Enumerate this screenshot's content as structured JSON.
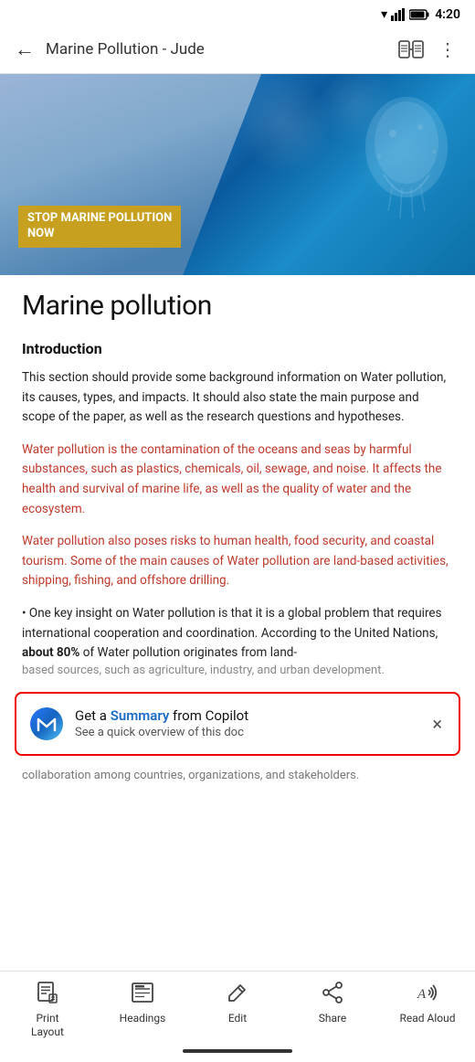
{
  "status_bar": {
    "time": "4:20"
  },
  "top_nav": {
    "title": "Marine Pollution - Jude",
    "back_label": "←",
    "more_label": "⋮"
  },
  "hero": {
    "text_line1": "STOP MARINE POLLUTION",
    "text_line2": "NOW"
  },
  "document": {
    "title": "Marine pollution",
    "section1_heading": "Introduction",
    "body_para1": "This section should provide some background information on Water pollution, its causes, types, and impacts. It should also state the main purpose and scope of the paper, as well as the research questions and hypotheses.",
    "red_para1": "Water pollution is the contamination of the oceans and seas by harmful substances, such as plastics, chemicals, oil, sewage, and noise. It affects the health and survival of marine life, as well as the quality of water and the ecosystem.",
    "red_para2": "Water pollution also poses risks to human health, food security, and coastal tourism. Some of the main causes of Water pollution are land-based activities, shipping, fishing, and offshore drilling.",
    "mixed_para_start": "• One key insight on Water pollution is that it is a global problem that requires international cooperation and coordination. According to the United Nations, ",
    "mixed_para_bold": "about 80%",
    "mixed_para_end": " of Water pollution originates from land-based sources, such as agriculture, industry, and urban development.",
    "trailing_text": "collaboration among countries, organizations, and stakeholders."
  },
  "copilot_banner": {
    "title_prefix": "Get a ",
    "title_link": "Summary",
    "title_suffix": " from Copilot",
    "subtitle": "See a quick overview of this doc",
    "close_label": "×"
  },
  "toolbar": {
    "items": [
      {
        "id": "print-layout",
        "icon": "print-layout-icon",
        "label": "Print\nLayout"
      },
      {
        "id": "headings",
        "icon": "headings-icon",
        "label": "Headings"
      },
      {
        "id": "edit",
        "icon": "edit-icon",
        "label": "Edit"
      },
      {
        "id": "share",
        "icon": "share-icon",
        "label": "Share"
      },
      {
        "id": "read-aloud",
        "icon": "read-aloud-icon",
        "label": "Read Aloud"
      }
    ]
  }
}
